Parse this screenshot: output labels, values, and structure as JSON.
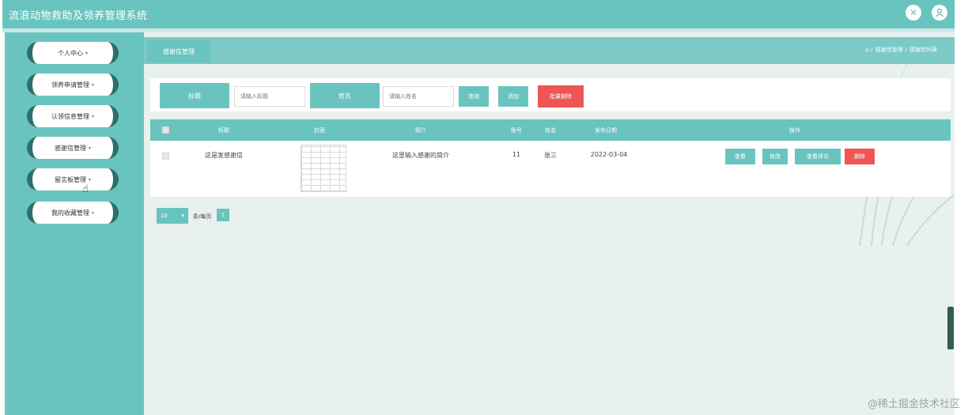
{
  "header": {
    "title": "流浪动物救助及领养管理系统",
    "fullscreen_icon": "fullscreen-icon",
    "user_icon": "user-icon"
  },
  "sidebar": {
    "items": [
      {
        "label": "个人中心"
      },
      {
        "label": "领养申请管理"
      },
      {
        "label": "认领信息管理"
      },
      {
        "label": "感谢信管理"
      },
      {
        "label": "留言板管理"
      },
      {
        "label": "我的收藏管理"
      }
    ]
  },
  "breadcrumb_bar": {
    "tab_label": "感谢信管理",
    "home_icon": "home-icon",
    "path": [
      "感谢信管理",
      "感谢信列表"
    ],
    "separator": "/"
  },
  "search": {
    "title_label": "标题",
    "title_placeholder": "请输入标题",
    "name_label": "姓名",
    "name_placeholder": "请输入姓名",
    "query_button": "查询",
    "add_button": "添加",
    "batch_delete_button": "批量删除"
  },
  "table": {
    "headers": [
      "标题",
      "封面",
      "简介",
      "账号",
      "姓名",
      "发布日期",
      "操作"
    ],
    "rows": [
      {
        "title": "这是发感谢信",
        "intro": "这里输入感谢的简介",
        "account": "11",
        "name": "张三",
        "date": "2022-03-04",
        "actions": [
          "查看",
          "修改",
          "查看评论",
          "删除"
        ]
      }
    ]
  },
  "pagination": {
    "page_size": "10",
    "page_size_suffix": "条/每页",
    "current_page": "1"
  },
  "watermark": "@稀土掘金技术社区",
  "colors": {
    "primary": "#69c4bf",
    "danger": "#ef5555",
    "sidebar_accent": "#2d6f6a",
    "main_bg": "#e8f1ee"
  }
}
